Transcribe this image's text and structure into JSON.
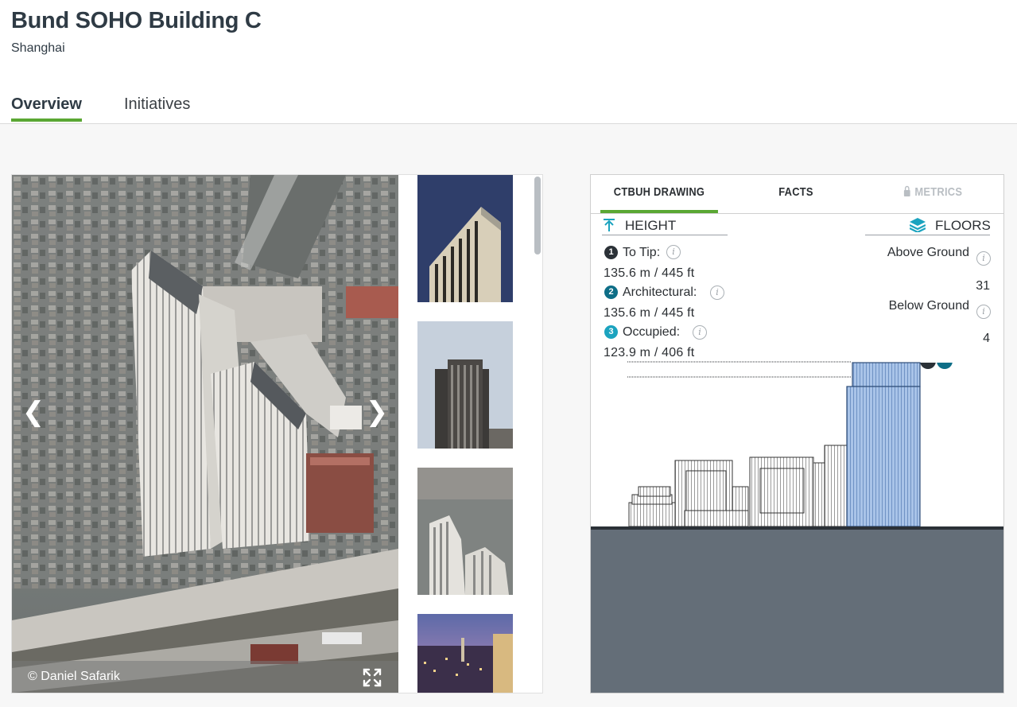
{
  "header": {
    "title": "Bund SOHO Building C",
    "city": "Shanghai",
    "tabs": [
      {
        "label": "Overview",
        "active": true
      },
      {
        "label": "Initiatives",
        "active": false
      }
    ]
  },
  "gallery": {
    "photo_credit": "© Daniel Safarik",
    "prev_icon": "chevron-left-icon",
    "next_icon": "chevron-right-icon",
    "expand_icon": "expand-icon",
    "thumbnail_count": 4
  },
  "panel": {
    "tabs": [
      {
        "label": "CTBUH DRAWING",
        "active": true
      },
      {
        "label": "FACTS",
        "active": false
      },
      {
        "label": "METRICS",
        "locked": true,
        "icon": "lock-icon"
      }
    ],
    "height": {
      "title": "HEIGHT",
      "rows": [
        {
          "badge": "1",
          "label": "To Tip:",
          "value": "135.6 m / 445 ft"
        },
        {
          "badge": "2",
          "label": "Architectural:",
          "value": "135.6 m / 445 ft"
        },
        {
          "badge": "3",
          "label": "Occupied:",
          "value": "123.9 m / 406 ft"
        }
      ]
    },
    "floors": {
      "title": "FLOORS",
      "above_label": "Above Ground",
      "above_value": "31",
      "below_label": "Below Ground",
      "below_value": "4"
    },
    "colors": {
      "accent_green": "#5aa733",
      "badge_dark": "#2b3137",
      "badge_teal": "#0e6e87",
      "badge_light": "#1ba3bf",
      "ground": "#646e78",
      "building_highlight": "#9dbce3"
    }
  }
}
